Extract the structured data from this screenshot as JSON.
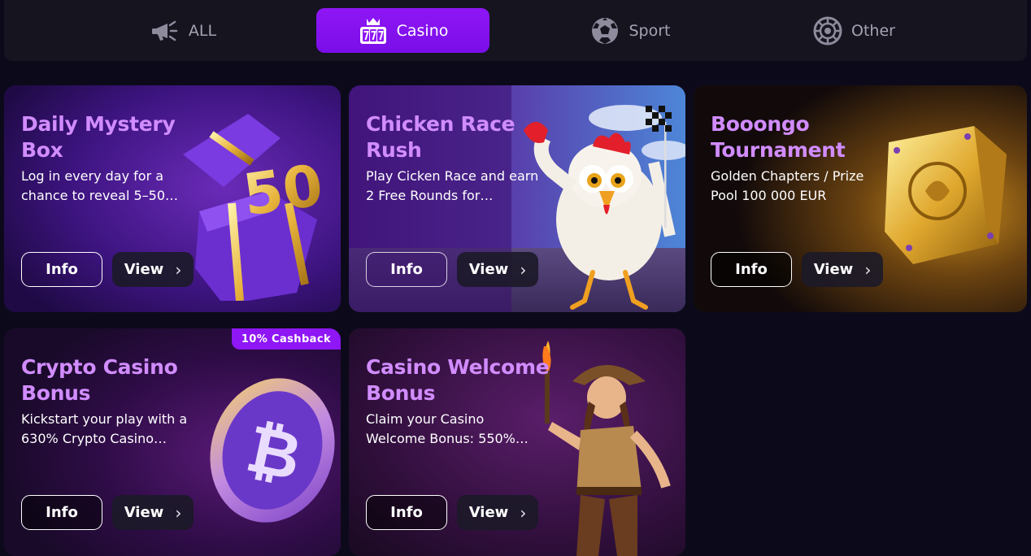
{
  "tabs": [
    {
      "label": "ALL",
      "icon": "megaphone-icon",
      "active": false
    },
    {
      "label": "Casino",
      "icon": "slot-777-icon",
      "active": true
    },
    {
      "label": "Sport",
      "icon": "soccer-ball-icon",
      "active": false
    },
    {
      "label": "Other",
      "icon": "roulette-wheel-icon",
      "active": false
    }
  ],
  "colors": {
    "accent": "#8f16f5",
    "title": "#d18cff",
    "background": "#0c0a1a",
    "tabbar": "#15141f"
  },
  "cards": [
    {
      "title": "Daily Mystery Box",
      "description": "Log in every day for a chance to reveal 5–50…",
      "info_label": "Info",
      "view_label": "View",
      "image": "purple gift box with gold 50"
    },
    {
      "title": "Chicken Race Rush",
      "description": "Play Cicken Race and earn 2 Free Rounds for…",
      "info_label": "Info",
      "view_label": "View",
      "image": "chicken holding racing flag"
    },
    {
      "title": "Booongo Tournament",
      "description": "Golden Chapters / Prize Pool 100 000 EUR",
      "info_label": "Info",
      "view_label": "View",
      "image": "golden book"
    },
    {
      "title": "Crypto Casino Bonus",
      "description": "Kickstart your play with a 630% Crypto Casino…",
      "info_label": "Info",
      "view_label": "View",
      "badge": "10% Cashback",
      "image": "bitcoin coin"
    },
    {
      "title": "Casino Welcome Bonus",
      "description": "Claim your Casino Welcome Bonus: 550%…",
      "info_label": "Info",
      "view_label": "View",
      "image": "explorer woman with torch"
    }
  ]
}
